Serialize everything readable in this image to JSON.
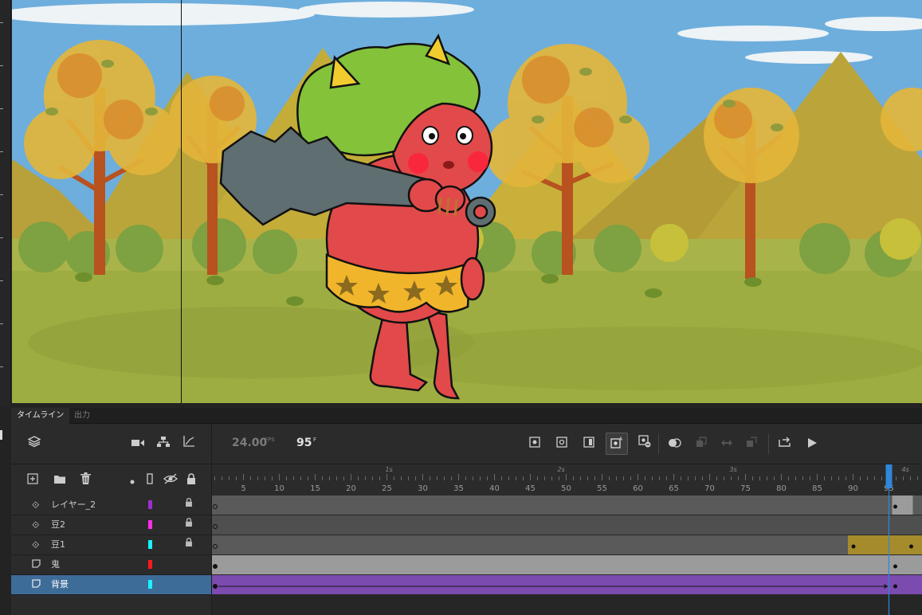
{
  "panel_tabs": {
    "timeline": "タイムライン",
    "output": "出力"
  },
  "playback": {
    "fps_value": "24.00",
    "fps_unit": "FPS",
    "current_frame": "95",
    "frame_unit": "F"
  },
  "ruler": {
    "frame_labels": [
      "5",
      "10",
      "15",
      "20",
      "25",
      "30",
      "35",
      "40",
      "45",
      "50",
      "55",
      "60",
      "65",
      "70",
      "75",
      "80",
      "85",
      "90",
      "95"
    ],
    "second_labels": [
      "1s",
      "2s",
      "3s",
      "4s"
    ],
    "playhead_frame": 95
  },
  "layers": [
    {
      "name": "レイヤー_2",
      "icon": "motion-tween-layer-icon",
      "color": "#9b2fd0",
      "locked": true
    },
    {
      "name": "豆2",
      "icon": "motion-tween-layer-icon",
      "color": "#ff2fe9",
      "locked": true
    },
    {
      "name": "豆1",
      "icon": "motion-tween-layer-icon",
      "color": "#19f3ff",
      "locked": true
    },
    {
      "name": "鬼",
      "icon": "layer-page-icon",
      "color": "#ff1a1a",
      "locked": false
    },
    {
      "name": "背景",
      "icon": "layer-page-icon",
      "color": "#19f3ff",
      "locked": false,
      "selected": true
    }
  ],
  "colors": {
    "accent": "#3d6c99",
    "playhead": "#2f87d8",
    "tween_purple": "#7b4bb0",
    "tween_gold": "#a58b2c"
  }
}
